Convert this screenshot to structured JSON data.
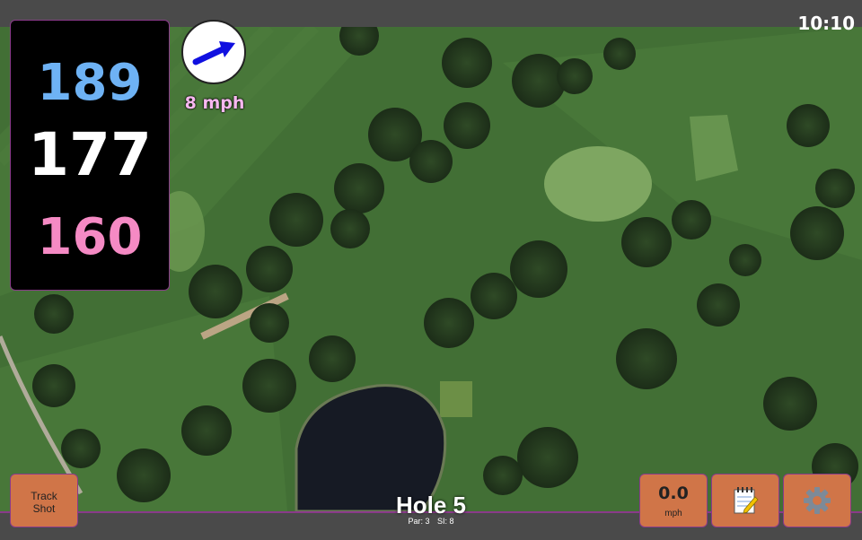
{
  "status": {
    "time": "10:10"
  },
  "yardage": {
    "back": "189",
    "middle": "177",
    "front": "160",
    "colors": {
      "back": "#6eb2f4",
      "middle": "#ffffff",
      "front": "#f58ac4"
    }
  },
  "wind": {
    "speed_label": "8 mph",
    "icon": "wind-arrow-icon",
    "arrow_color": "#1010e0",
    "label_color": "#f7b8f0"
  },
  "buttons": {
    "track_shot": {
      "line1": "Track",
      "line2": "Shot"
    },
    "wind_adjust": {
      "value": "0.0",
      "unit": "mph"
    },
    "notes": {
      "icon": "notepad-icon"
    },
    "settings": {
      "icon": "gear-icon"
    },
    "button_color": "#d07548"
  },
  "hole": {
    "title": "Hole 5",
    "par": "Par: 3",
    "si": "SI: 8"
  },
  "map": {
    "description_icon": "satellite-map"
  }
}
